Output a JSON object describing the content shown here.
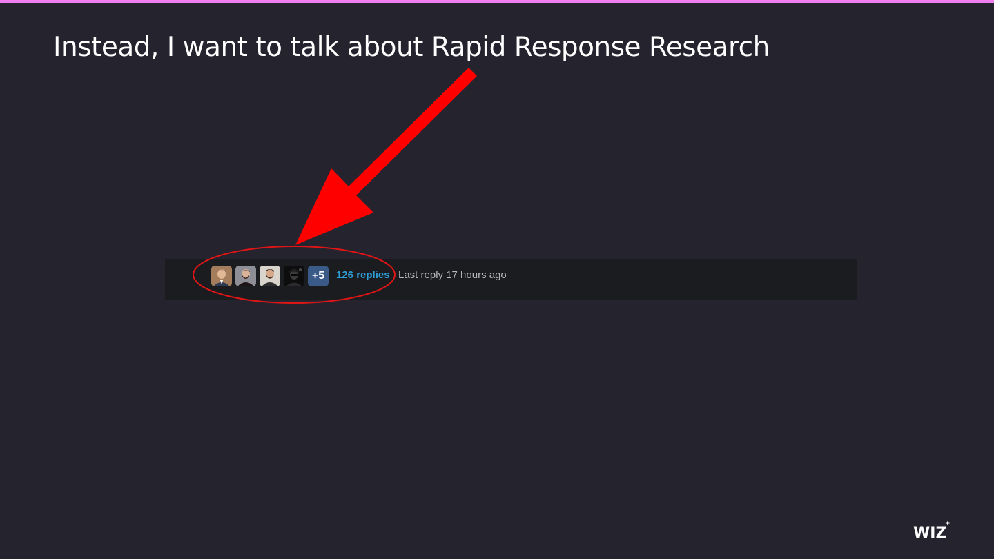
{
  "slide": {
    "title": "Instead, I want to talk about Rapid Response Research"
  },
  "thread": {
    "avatars": [
      {
        "name": "participant-1",
        "color": "#b07a5a"
      },
      {
        "name": "participant-2",
        "color": "#9a8f88"
      },
      {
        "name": "participant-3",
        "color": "#c9c3ba"
      },
      {
        "name": "participant-4",
        "color": "#111111"
      }
    ],
    "more_count": "+5",
    "replies_label": "126 replies",
    "last_reply": "Last reply 17 hours ago"
  },
  "logo": {
    "text": "WIZ",
    "spark": "+"
  },
  "colors": {
    "accent_bar": "#f07ef0",
    "link": "#2f9fd8",
    "annotation": "#ff0000"
  }
}
